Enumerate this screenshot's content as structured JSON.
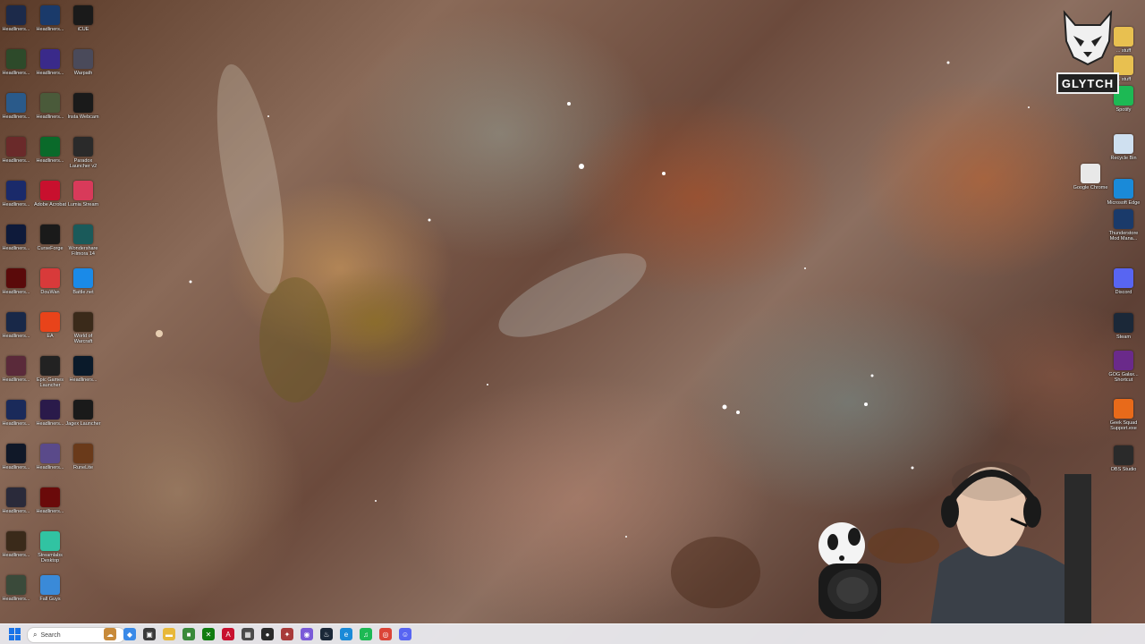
{
  "desktop": {
    "left_column_1": [
      {
        "label": "Headliners...",
        "color": "#1c2a4a",
        "icon": "game-icon"
      },
      {
        "label": "Headliners...",
        "color": "#2d4a2a",
        "icon": "game-icon"
      },
      {
        "label": "Headliners...",
        "color": "#2a5a8a",
        "icon": "game-icon"
      },
      {
        "label": "Headliners...",
        "color": "#6a2a2a",
        "icon": "game-icon"
      },
      {
        "label": "Headliners...",
        "color": "#1a2a6a",
        "icon": "game-icon"
      },
      {
        "label": "Headliners...",
        "color": "#0e1a3a",
        "icon": "game-icon"
      },
      {
        "label": "Headliners...",
        "color": "#5a0a0a",
        "icon": "game-icon"
      },
      {
        "label": "Headliners...",
        "color": "#182848",
        "icon": "game-icon"
      },
      {
        "label": "Headliners...",
        "color": "#5a2a3a",
        "icon": "game-icon"
      },
      {
        "label": "Headliners...",
        "color": "#1a2a5a",
        "icon": "game-icon"
      },
      {
        "label": "Headliners...",
        "color": "#101828",
        "icon": "game-icon"
      },
      {
        "label": "Headliners...",
        "color": "#2a2a3a",
        "icon": "game-icon"
      },
      {
        "label": "Headliners...",
        "color": "#3a2a1a",
        "icon": "game-icon"
      },
      {
        "label": "Headliners...",
        "color": "#3a4a3a",
        "icon": "game-icon"
      }
    ],
    "left_column_2": [
      {
        "label": "Headliners...",
        "color": "#1a3a6a",
        "icon": "game-icon"
      },
      {
        "label": "Headliners...",
        "color": "#3a2a8a",
        "icon": "game-icon"
      },
      {
        "label": "Headliners...",
        "color": "#4a5a3a",
        "icon": "game-icon"
      },
      {
        "label": "Headliners...",
        "color": "#0a6a2a",
        "icon": "game-icon"
      },
      {
        "label": "Adobe Acrobat",
        "color": "#c8102e",
        "icon": "acrobat-icon"
      },
      {
        "label": "CurseForge",
        "color": "#1a1a1a",
        "icon": "curseforge-icon"
      },
      {
        "label": "DouWan",
        "color": "#d83a3a",
        "icon": "douwan-icon"
      },
      {
        "label": "EA",
        "color": "#e8431a",
        "icon": "ea-icon"
      },
      {
        "label": "Epic Games Launcher",
        "color": "#222222",
        "icon": "epic-games-icon"
      },
      {
        "label": "Headliners...",
        "color": "#2a1a4a",
        "icon": "game-icon"
      },
      {
        "label": "Headliners...",
        "color": "#5a4a8a",
        "icon": "game-icon"
      },
      {
        "label": "Headliners...",
        "color": "#6a0a0a",
        "icon": "game-icon"
      },
      {
        "label": "Streamlabs Desktop",
        "color": "#31c3a2",
        "icon": "streamlabs-icon"
      },
      {
        "label": "Fall Guys",
        "color": "#3a8ad8",
        "icon": "fall-guys-icon"
      }
    ],
    "left_column_3": [
      {
        "label": "iCUE",
        "color": "#1a1a1a",
        "icon": "icue-icon"
      },
      {
        "label": "Warpath",
        "color": "#4a4a5a",
        "icon": "warpath-icon"
      },
      {
        "label": "Insta Webcam",
        "color": "#1a1a1a",
        "icon": "webcam-app-icon"
      },
      {
        "label": "Paradox Launcher v2",
        "color": "#2a2a2a",
        "icon": "paradox-icon"
      },
      {
        "label": "Lumia Stream",
        "color": "#d83a5a",
        "icon": "lumia-icon"
      },
      {
        "label": "Wondershare Filmora 14",
        "color": "#1a5a5a",
        "icon": "filmora-icon"
      },
      {
        "label": "Battle.net",
        "color": "#1a8ae8",
        "icon": "battlenet-icon"
      },
      {
        "label": "World of Warcraft",
        "color": "#3a2a1a",
        "icon": "wow-icon"
      },
      {
        "label": "Headliners...",
        "color": "#0a1a2a",
        "icon": "game-icon"
      },
      {
        "label": "Jagex Launcher",
        "color": "#1a1a1a",
        "icon": "jagex-icon"
      },
      {
        "label": "RuneLite",
        "color": "#6a3a1a",
        "icon": "runelite-icon"
      }
    ],
    "right_column_1": [
      {
        "label": "Google Chrome",
        "color": "#e8e8e8",
        "icon": "chrome-icon"
      }
    ],
    "right_column_2": [
      {
        "label": "... stuff",
        "color": "#e8c050",
        "icon": "folder-icon"
      },
      {
        "label": "... stuff",
        "color": "#e8c050",
        "icon": "folder-icon"
      },
      {
        "label": "Spotify",
        "color": "#1db954",
        "icon": "spotify-icon"
      },
      {
        "label": "Recycle Bin",
        "color": "#cfe0f0",
        "icon": "recycle-bin-icon"
      },
      {
        "label": "Microsoft Edge",
        "color": "#1a8ad8",
        "icon": "edge-icon"
      },
      {
        "label": "Thunderstore Mod Mana...",
        "color": "#1a3a6a",
        "icon": "thunderstore-icon"
      },
      {
        "label": "Discord",
        "color": "#5865f2",
        "icon": "discord-icon"
      },
      {
        "label": "Steam",
        "color": "#1b2838",
        "icon": "steam-icon"
      },
      {
        "label": "GOG Galax... Shortcut",
        "color": "#6a2a8a",
        "icon": "gog-icon"
      },
      {
        "label": "Geek Squad Support.exe",
        "color": "#e86a1a",
        "icon": "geek-squad-icon"
      },
      {
        "label": "OBS Studio",
        "color": "#2a2a2a",
        "icon": "obs-icon"
      }
    ]
  },
  "overlay": {
    "logo_text": "GLYTCH"
  },
  "taskbar": {
    "search_placeholder": "Search",
    "pinned": [
      {
        "name": "taskbar-widgets-icon",
        "color": "#c88a3a",
        "glyph": "☁"
      },
      {
        "name": "taskbar-copilot-icon",
        "color": "#3a8ae8",
        "glyph": "◆"
      },
      {
        "name": "taskbar-taskview-icon",
        "color": "#3a3a3a",
        "glyph": "▣"
      },
      {
        "name": "taskbar-explorer-icon",
        "color": "#e8b83a",
        "glyph": "▬"
      },
      {
        "name": "taskbar-minecraft-icon",
        "color": "#3a8a3a",
        "glyph": "■"
      },
      {
        "name": "taskbar-xbox-icon",
        "color": "#107c10",
        "glyph": "✕"
      },
      {
        "name": "taskbar-acrobat-icon",
        "color": "#c8102e",
        "glyph": "A"
      },
      {
        "name": "taskbar-app-icon",
        "color": "#4a4a4a",
        "glyph": "▦"
      },
      {
        "name": "taskbar-obs-icon",
        "color": "#2a2a2a",
        "glyph": "●"
      },
      {
        "name": "taskbar-davinci-icon",
        "color": "#a83a3a",
        "glyph": "✦"
      },
      {
        "name": "taskbar-lumia-icon",
        "color": "#7a5ad8",
        "glyph": "◉"
      },
      {
        "name": "taskbar-steam-icon",
        "color": "#1b2838",
        "glyph": "♨"
      },
      {
        "name": "taskbar-edge-icon",
        "color": "#1a8ad8",
        "glyph": "e"
      },
      {
        "name": "taskbar-spotify-icon",
        "color": "#1db954",
        "glyph": "♫"
      },
      {
        "name": "taskbar-chrome-icon",
        "color": "#db4437",
        "glyph": "◎"
      },
      {
        "name": "taskbar-discord-icon",
        "color": "#5865f2",
        "glyph": "☺"
      }
    ]
  }
}
